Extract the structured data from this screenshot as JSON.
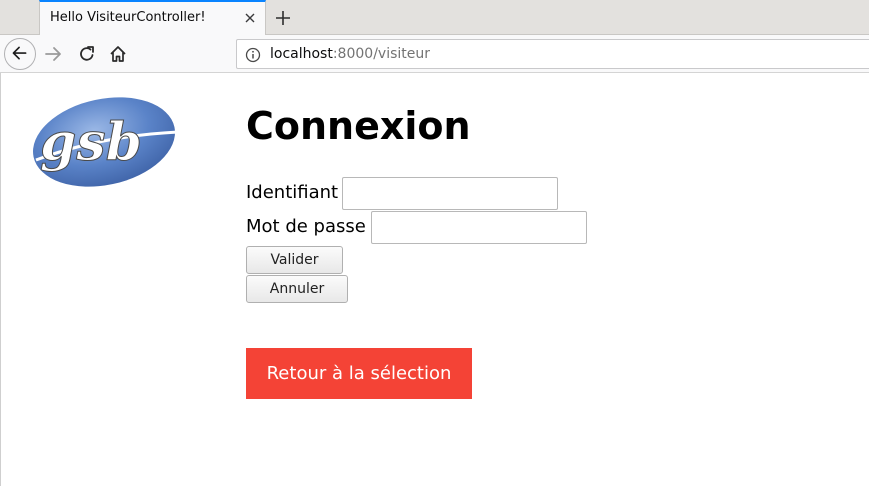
{
  "browser": {
    "tab_title": "Hello VisiteurController!",
    "url_host": "localhost",
    "url_rest": ":8000/visiteur"
  },
  "icons": {
    "back": "arrow-left-icon",
    "forward": "arrow-right-icon",
    "reload": "reload-icon",
    "home": "home-icon",
    "info": "info-icon",
    "close": "close-icon",
    "new_tab": "plus-icon"
  },
  "logo": {
    "text": "gsb"
  },
  "page": {
    "title": "Connexion",
    "form": {
      "identifiant_label": "Identifiant",
      "identifiant_value": "",
      "password_label": "Mot de passe",
      "password_value": "",
      "submit_label": "Valider",
      "reset_label": "Annuler"
    },
    "back_button_label": "Retour à la sélection"
  },
  "colors": {
    "accent_tab": "#0a84ff",
    "back_button_bg": "#f44336",
    "back_button_text": "#ffffff",
    "logo_blue": "#4f79c0"
  }
}
